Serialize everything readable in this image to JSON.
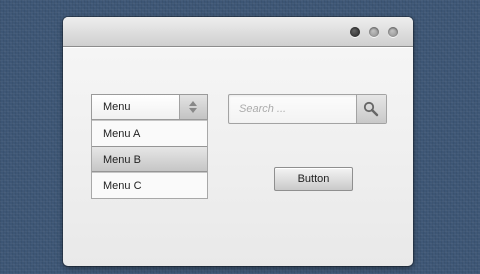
{
  "window": {
    "controls": [
      "dark-circle-icon",
      "gray-circle-icon",
      "gray-circle-icon"
    ]
  },
  "select": {
    "value": "Menu",
    "arrow_icon": "up-down-arrows-icon",
    "options": [
      "Menu A",
      "Menu B",
      "Menu C"
    ],
    "selected": "Menu B"
  },
  "search": {
    "placeholder": "Search ...",
    "value": "",
    "button_icon": "magnifier-icon"
  },
  "button": {
    "label": "Button"
  },
  "colors": {
    "background": "#3d5675",
    "window": "#f3f3f3"
  }
}
